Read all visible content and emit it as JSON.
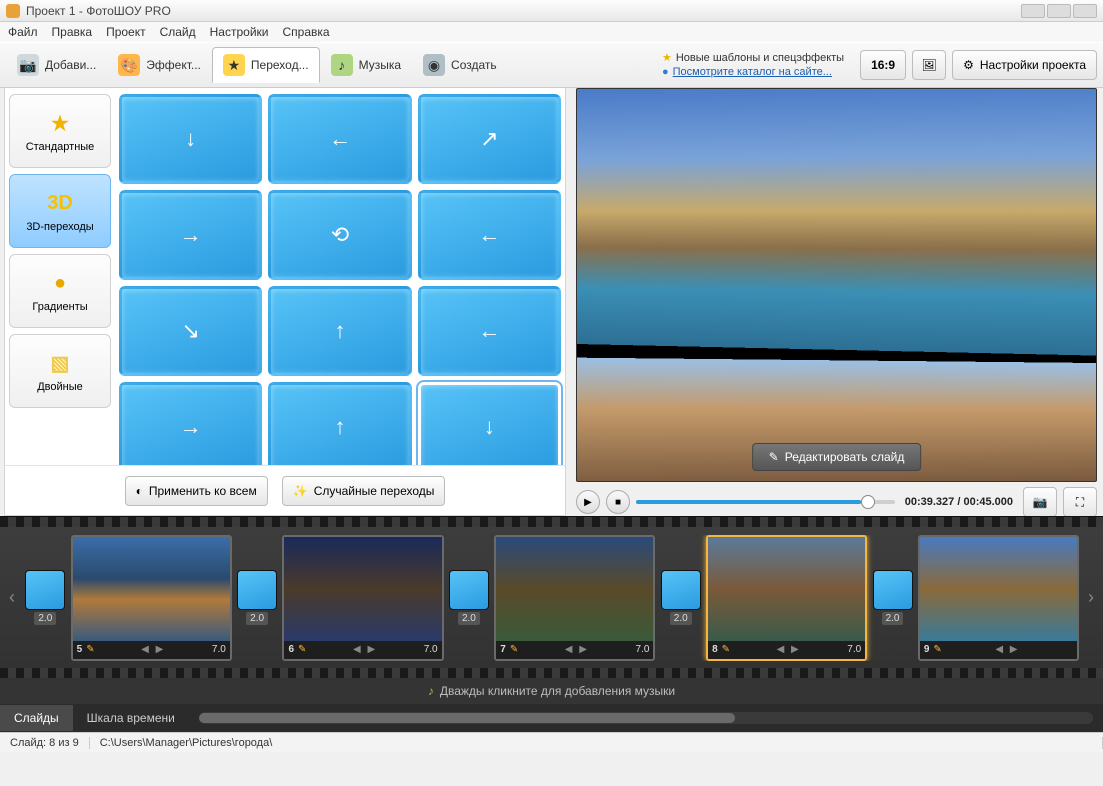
{
  "window": {
    "title": "Проект 1 - ФотоШОУ PRO"
  },
  "menu": [
    "Файл",
    "Правка",
    "Проект",
    "Слайд",
    "Настройки",
    "Справка"
  ],
  "tabs": {
    "add": "Добави...",
    "effects": "Эффект...",
    "transitions": "Переход...",
    "music": "Музыка",
    "create": "Создать"
  },
  "info": {
    "templates": "Новые шаблоны и спецэффекты",
    "catalog": "Посмотрите каталог на сайте..."
  },
  "aspect": "16:9",
  "settings_btn": "Настройки проекта",
  "categories": {
    "standard": "Стандартные",
    "threeD": "3D-переходы",
    "gradients": "Градиенты",
    "double": "Двойные",
    "threeD_icon": "3D"
  },
  "apply_all": "Применить ко всем",
  "random": "Случайные переходы",
  "edit_slide": "Редактировать слайд",
  "time": {
    "current": "00:39.327",
    "total": "00:45.000",
    "sep": " / "
  },
  "timeline": {
    "music_hint": "Дважды кликните для добавления музыки",
    "tab_slides": "Слайды",
    "tab_scale": "Шкала времени",
    "trans_duration": "2.0",
    "slides": [
      {
        "num": "5",
        "dur": "7.0"
      },
      {
        "num": "6",
        "dur": "7.0"
      },
      {
        "num": "7",
        "dur": "7.0"
      },
      {
        "num": "8",
        "dur": "7.0"
      },
      {
        "num": "9",
        "dur": ""
      }
    ],
    "selected_index": 3
  },
  "status": {
    "slide": "Слайд: 8 из 9",
    "path": "C:\\Users\\Manager\\Pictures\\города\\"
  }
}
